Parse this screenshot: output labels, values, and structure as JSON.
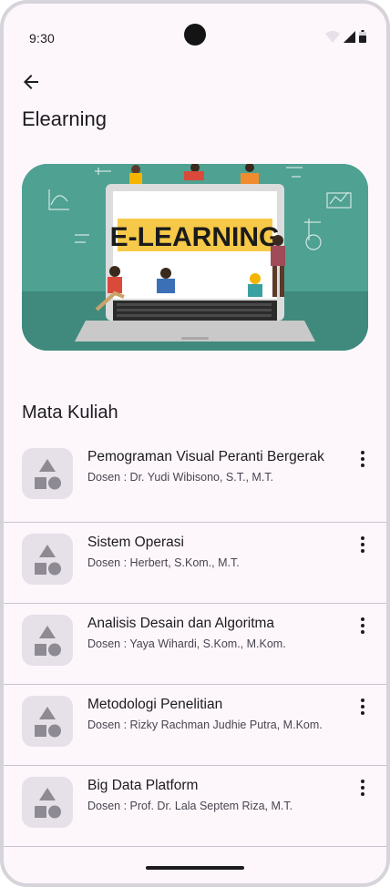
{
  "status_bar": {
    "time": "9:30"
  },
  "app_bar": {
    "title": "Elearning",
    "back_icon": "arrow-back-icon"
  },
  "banner": {
    "label": "E-LEARNING"
  },
  "section": {
    "title": "Mata Kuliah"
  },
  "courses": [
    {
      "name": "Pemograman Visual Peranti Bergerak",
      "lecturer": "Dosen : Dr. Yudi Wibisono, S.T., M.T."
    },
    {
      "name": "Sistem Operasi",
      "lecturer": "Dosen : Herbert, S.Kom., M.T."
    },
    {
      "name": "Analisis Desain dan Algoritma",
      "lecturer": "Dosen : Yaya Wihardi, S.Kom., M.Kom."
    },
    {
      "name": "Metodologi Penelitian",
      "lecturer": "Dosen : Rizky Rachman Judhie Putra, M.Kom."
    },
    {
      "name": "Big Data Platform",
      "lecturer": "Dosen : Prof. Dr. Lala Septem Riza, M.T."
    }
  ],
  "colors": {
    "background": "#fdf7fc",
    "banner_teal": "#4fa192",
    "divider": "#cac4d0",
    "thumb": "#e6e0e9"
  }
}
